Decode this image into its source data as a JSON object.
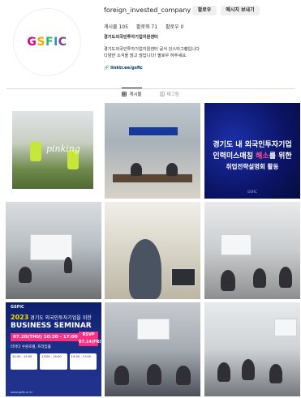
{
  "profile": {
    "logo_text": "GSFIC",
    "username": "foreign_invested_company",
    "follow_label": "팔로우",
    "message_label": "메시지 보내기",
    "stats": {
      "posts": "게시물 105",
      "followers": "팔로워 71",
      "following": "팔로우 0"
    },
    "bio": {
      "name": "경기도외국인투자기업지원센터",
      "dot": ".",
      "line1": "경기도외국인투자기업지원센터 공식 인스타그램입니다",
      "line2": "다양한 소식을 많고 많답니다! 팔로우 하주세요.",
      "dot2": ".",
      "link": "linktr.ee/gsfic"
    }
  },
  "tabs": [
    {
      "icon": "grid-icon",
      "label": "게시물"
    },
    {
      "icon": "tag-icon",
      "label": "태그됨"
    }
  ],
  "posts": {
    "p1": {
      "script": "pinking"
    },
    "p3": {
      "line1": "경기도 내 외국인투자기업",
      "line2a": "인력미스매칭 ",
      "line2b": "해소",
      "line2c": "를 위한",
      "line3": "취업전략설명회 활동",
      "footer": "GSFIC"
    },
    "p7": {
      "header": "GSFIC",
      "year": "2023",
      "year_suffix": " 경기도 외국인투자기업을 위한",
      "title": "BUSINESS SEMINAR",
      "date": "07.20(THU) 10:30 - 17:00",
      "rsvp": "RSVP",
      "rsvp_date": "07.14(FRI)",
      "venue": "라마다 수원호텔, 프라임홀",
      "box1": "10:30 - 12:00",
      "box2": "13:00 - 15:00",
      "box3": "15:00 - 17:00",
      "footer": "www.gsfic.or.kr"
    }
  },
  "colors": {
    "accent_pink": "#ff2d84",
    "banner_blue": "#0d1f6b"
  }
}
